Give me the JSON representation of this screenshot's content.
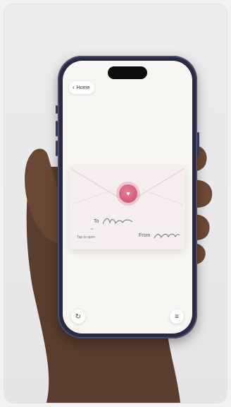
{
  "screen": {
    "nav": {
      "home_label": "Home",
      "back_icon": "chevron-left-icon"
    },
    "envelope": {
      "to_label": "To",
      "from_label": "From",
      "seal_icon": "heart-icon",
      "seal_color": "#d96a86",
      "tap_label": "Tap to open",
      "tap_icon": "chevron-up-icon"
    },
    "controls": {
      "replay_icon": "refresh-icon",
      "menu_icon": "menu-icon"
    }
  }
}
